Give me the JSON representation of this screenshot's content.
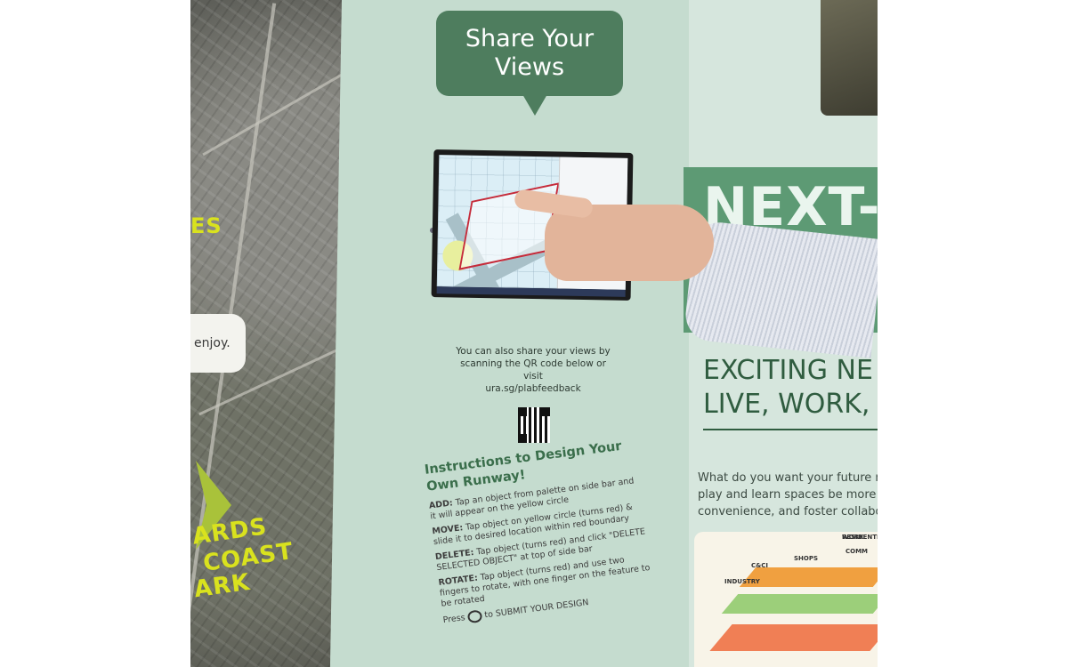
{
  "map": {
    "label_top": "ES",
    "pill_text": "enjoy.",
    "label_bottom": [
      "ARDS",
      "COAST",
      "ARK"
    ]
  },
  "speech_bubble": {
    "line1": "Share Your",
    "line2": "Views"
  },
  "qr_hint": {
    "line1": "You can also share your views by",
    "line2": "scanning the QR code below or visit",
    "line3": "ura.sg/plabfeedback"
  },
  "instructions": {
    "title_line1": "Instructions to Design Your",
    "title_line2": "Own Runway!",
    "add_key": "ADD:",
    "add_text": "Tap an object from palette on side bar and it will appear on the yellow circle",
    "move_key": "MOVE:",
    "move_text": "Tap object on yellow circle (turns red) & slide it to desired location within red boundary",
    "delete_key": "DELETE:",
    "delete_text": "Tap object (turns red) and click \"DELETE SELECTED OBJECT\" at top of side bar",
    "rotate_key": "ROTATE:",
    "rotate_text": "Tap object (turns red) and use two fingers to rotate, with one finger on the feature to be rotated",
    "press_prefix": "Press",
    "press_suffix": "to SUBMIT YOUR DESIGN"
  },
  "right_panel": {
    "next_title": "NEXT-G",
    "exciting_line1": "EXCITING NE",
    "exciting_line2": "LIVE, WORK,",
    "desc_line1": "What do you want your future nei",
    "desc_line2": "play and learn spaces be more cl",
    "desc_line3": "convenience, and foster collabora",
    "illus_labels": [
      "SMART WORK",
      "RESIDENTIAL",
      "SHOPS",
      "C&CI",
      "INDUSTRY",
      "COMM"
    ]
  }
}
